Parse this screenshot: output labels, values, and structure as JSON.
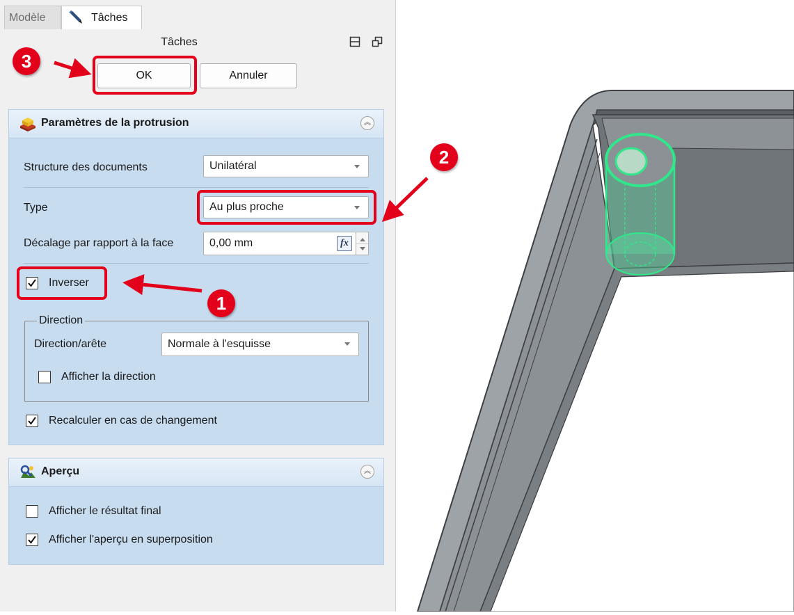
{
  "tabs": [
    {
      "label": "Modèle",
      "active": false
    },
    {
      "label": "Tâches",
      "active": true
    }
  ],
  "panel": {
    "title": "Tâches",
    "ok_label": "OK",
    "cancel_label": "Annuler"
  },
  "protrusion": {
    "title": "Paramètres de la protrusion",
    "structure_label": "Structure des documents",
    "structure_value": "Unilatéral",
    "type_label": "Type",
    "type_value": "Au plus proche",
    "offset_label": "Décalage par rapport à la face",
    "offset_value": "0,00 mm",
    "fx_label": "fx",
    "reverse_label": "Inverser",
    "reverse_checked": true,
    "direction": {
      "legend": "Direction",
      "edge_label": "Direction/arête",
      "edge_value": "Normale à l'esquisse",
      "show_direction_label": "Afficher la direction",
      "show_direction_checked": false
    },
    "recompute_label": "Recalculer en cas de changement",
    "recompute_checked": true
  },
  "preview": {
    "title": "Aperçu",
    "show_final_label": "Afficher le résultat final",
    "show_final_checked": false,
    "show_overlay_label": "Afficher l'aperçu en superposition",
    "show_overlay_checked": true
  },
  "annotations": {
    "step1": "1",
    "step2": "2",
    "step3": "3",
    "color": "#e3001b"
  },
  "colors": {
    "panel_group_bg": "#c8dcf0",
    "model_gray": "#8c9196",
    "model_highlight": "#2ee88a"
  },
  "icons": {
    "tab_tasks": "pencil-icon",
    "undock": "dock-icon",
    "float": "float-icon",
    "protrusion": "pad-icon",
    "preview": "preview-icon",
    "collapse": "chevron-up-double-icon"
  }
}
